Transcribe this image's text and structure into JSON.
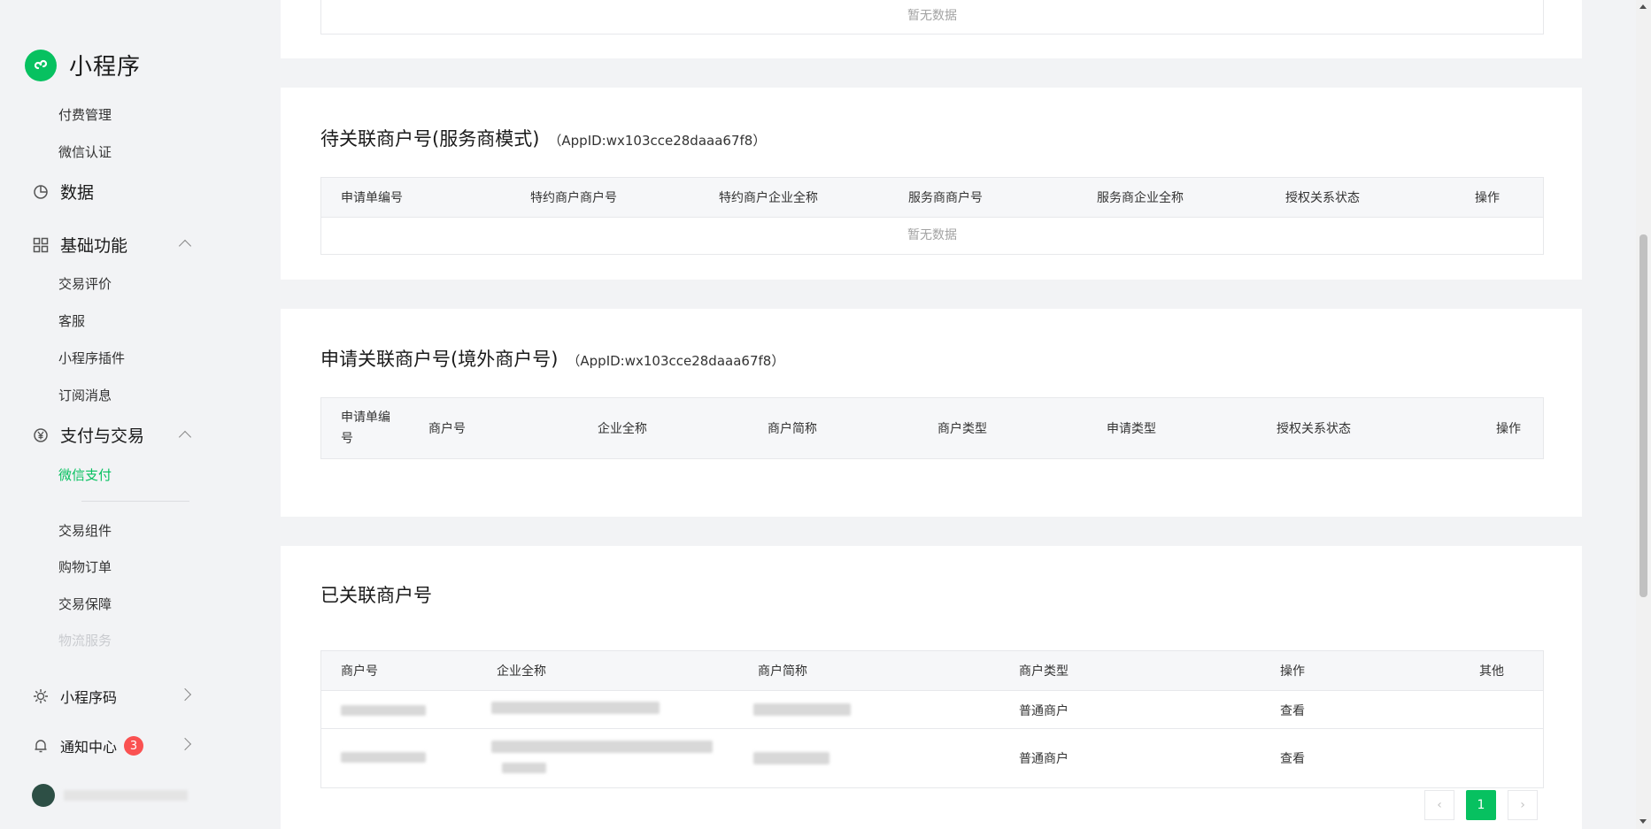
{
  "sidebar": {
    "brand": "小程序",
    "items_top": [
      "付费管理",
      "微信认证"
    ],
    "data_label": "数据",
    "basic": {
      "label": "基础功能",
      "items": [
        "交易评价",
        "客服",
        "小程序插件",
        "订阅消息"
      ]
    },
    "payment": {
      "label": "支付与交易",
      "items": [
        "微信支付",
        "交易组件",
        "购物订单",
        "交易保障",
        "物流服务"
      ]
    },
    "miniprogram_code": "小程序码",
    "notification": {
      "label": "通知中心",
      "count": "3"
    }
  },
  "section_top": {
    "empty_text": "暂无数据"
  },
  "section_service": {
    "title": "待关联商户号(服务商模式)",
    "appid": "（AppID:wx103cce28daaa67f8）",
    "columns": [
      "申请单编号",
      "特约商户商户号",
      "特约商户企业全称",
      "服务商商户号",
      "服务商企业全称",
      "授权关系状态",
      "操作"
    ],
    "empty_text": "暂无数据"
  },
  "section_overseas": {
    "title": "申请关联商户号(境外商户号)",
    "appid": "（AppID:wx103cce28daaa67f8）",
    "columns": [
      "申请单编号",
      "商户号",
      "企业全称",
      "商户简称",
      "商户类型",
      "申请类型",
      "授权关系状态",
      "操作"
    ]
  },
  "section_linked": {
    "title": "已关联商户号",
    "columns": [
      "商户号",
      "企业全称",
      "商户简称",
      "商户类型",
      "操作",
      "其他"
    ],
    "rows": [
      {
        "type": "普通商户",
        "action": "查看"
      },
      {
        "type": "普通商户",
        "action": "查看"
      }
    ]
  },
  "pagination": {
    "prev": "‹",
    "current": "1",
    "next": "›"
  },
  "colors": {
    "accent": "#07c160",
    "link": "#576b95",
    "badge": "#fa5151"
  }
}
